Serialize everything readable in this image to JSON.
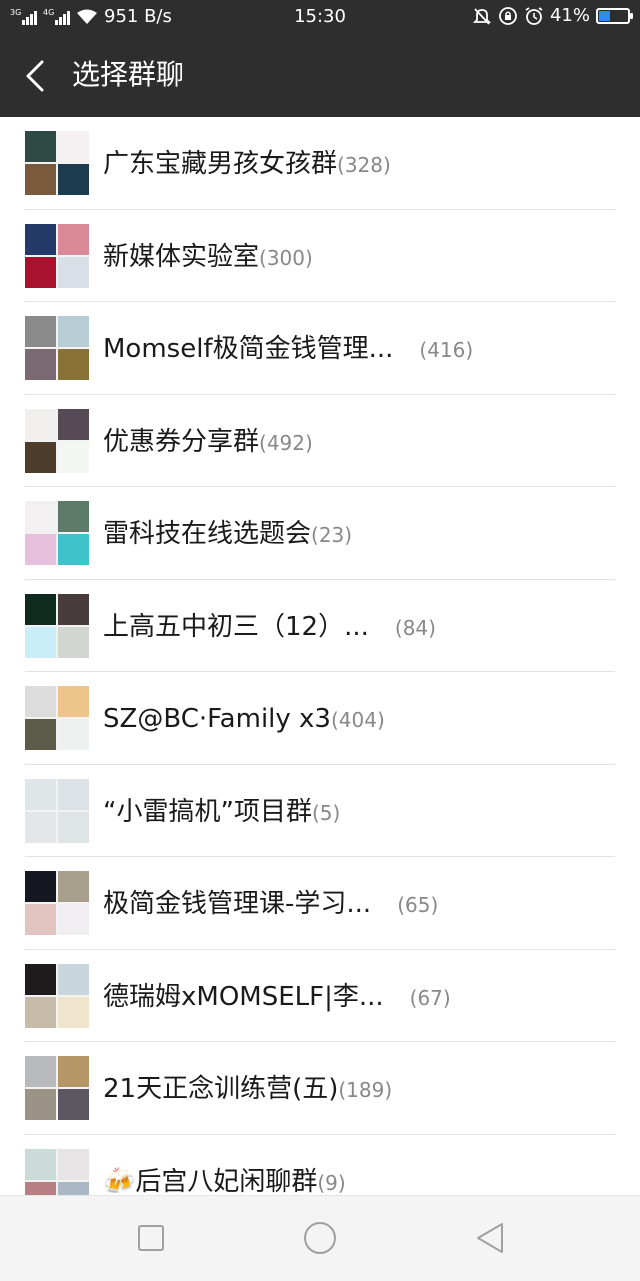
{
  "status_bar": {
    "network_left": "3G",
    "network_right": "4G",
    "speed": "951 B/s",
    "time": "15:30",
    "battery": "41%",
    "battery_level": 0.41,
    "icons": [
      "signal-icon",
      "wifi-icon",
      "mute-icon",
      "rotation-lock-icon",
      "alarm-icon",
      "battery-icon"
    ]
  },
  "header": {
    "title": "选择群聊"
  },
  "groups": [
    {
      "name": "广东宝藏男孩女孩群",
      "count": "(328)",
      "avatar": [
        "#2f4a44",
        "#f5f1f3",
        "#7a5a3c",
        "#1c3b4e"
      ]
    },
    {
      "name": "新媒体实验室",
      "count": "(300)",
      "avatar": [
        "#243a68",
        "#d98a96",
        "#a8122e",
        "#d9dfe6"
      ]
    },
    {
      "name": "Momself极简金钱管理...",
      "count": "(416)",
      "avatar": [
        "#8a8a8a",
        "#b7cdd6",
        "#7c6a72",
        "#8a7236"
      ]
    },
    {
      "name": "优惠券分享群",
      "count": "(492)",
      "avatar": [
        "#f1efee",
        "#564a55",
        "#4f3d2c",
        "#f4f6f3"
      ]
    },
    {
      "name": "雷科技在线选题会",
      "count": "(23)",
      "avatar": [
        "#f3f0f1",
        "#5d7b69",
        "#e6bfdc",
        "#3fc2c9"
      ]
    },
    {
      "name": "上高五中初三（12）...",
      "count": "(84)",
      "avatar": [
        "#0f2a1e",
        "#493c3f",
        "#c9eef8",
        "#d2d6d0"
      ]
    },
    {
      "name": "SZ@BC·Family x3",
      "count": "(404)",
      "avatar": [
        "#dcdcdc",
        "#ecc48c",
        "#5b5b48",
        "#eef1ef"
      ]
    },
    {
      "name": "“小雷搞机”项目群",
      "count": "(5)",
      "avatar": [
        "#e0e5e8",
        "#dde2e6",
        "#e3e7ea",
        "#dfe4e7"
      ]
    },
    {
      "name": "极简金钱管理课-学习...",
      "count": "(65)",
      "avatar": [
        "#151820",
        "#a89e8c",
        "#e2c4c0",
        "#f0eef0"
      ]
    },
    {
      "name": "德瑞姆xMOMSELF|李...",
      "count": "(67)",
      "avatar": [
        "#1d1b1b",
        "#c9d6de",
        "#c7bbaa",
        "#efe5cc"
      ]
    },
    {
      "name": "21天正念训练营(五)",
      "count": "(189)",
      "avatar": [
        "#b8b9bb",
        "#b59666",
        "#9a9386",
        "#5b5660"
      ]
    },
    {
      "name": "🍻后宫八妃闲聊群",
      "count": "(9)",
      "avatar": [
        "#cbdcd8",
        "#e6e4e4",
        "#b77f82",
        "#aab7c6"
      ]
    }
  ],
  "nav": {
    "icons": [
      "recent-apps-icon",
      "home-icon",
      "back-nav-icon"
    ]
  }
}
